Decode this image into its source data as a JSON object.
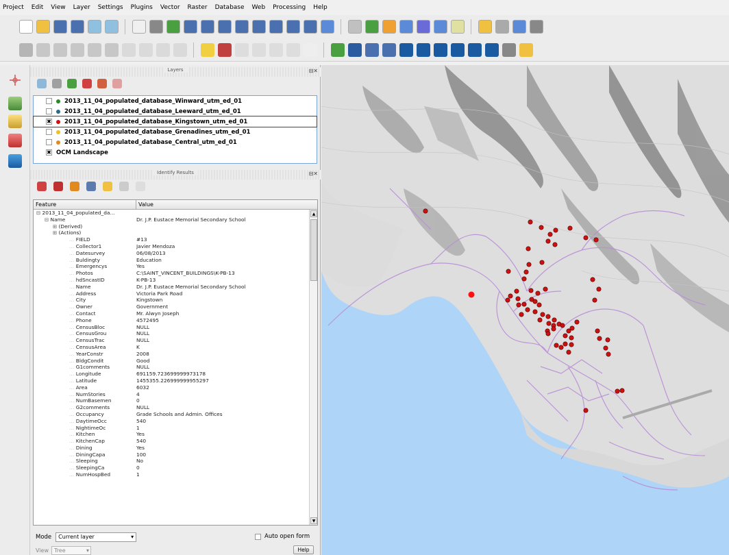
{
  "menu": [
    "Project",
    "Edit",
    "View",
    "Layer",
    "Settings",
    "Plugins",
    "Vector",
    "Raster",
    "Database",
    "Web",
    "Processing",
    "Help"
  ],
  "layers_panel": {
    "title": "Layers",
    "layers": [
      {
        "name": "2013_11_04_populated_database_Winward_utm_ed_01",
        "checked": false,
        "color": "#2a8a2a"
      },
      {
        "name": "2013_11_04_populated_database_Leeward_utm_ed_01",
        "checked": false,
        "color": "#2a6a8a"
      },
      {
        "name": "2013_11_04_populated_database_Kingstown_utm_ed_01",
        "checked": true,
        "color": "#cc1111",
        "selected": true
      },
      {
        "name": "2013_11_04_populated_database_Grenadines_utm_ed_01",
        "checked": false,
        "color": "#f0c020"
      },
      {
        "name": "2013_11_04_populated_database_Central_utm_ed_01",
        "checked": false,
        "color": "#e08a20"
      },
      {
        "name": "OCM Landscape",
        "checked": true
      }
    ]
  },
  "identify_panel": {
    "title": "Identify Results",
    "columns": [
      "Feature",
      "Value"
    ],
    "tree": [
      {
        "indent": 0,
        "toggle": "⊟",
        "feature": "2013_11_04_populated_da...",
        "value": ""
      },
      {
        "indent": 1,
        "toggle": "⊟",
        "feature": "Name",
        "value": "Dr. J.P. Eustace Memorial Secondary School"
      },
      {
        "indent": 2,
        "toggle": "⊞",
        "feature": "(Derived)",
        "value": ""
      },
      {
        "indent": 2,
        "toggle": "⊞",
        "feature": "(Actions)",
        "value": ""
      }
    ],
    "attributes": [
      [
        "FIELD",
        "#13"
      ],
      [
        "Collector1",
        "Javier Mendoza"
      ],
      [
        "Datesurvey",
        "06/08/2013"
      ],
      [
        "Buldingty",
        "Education"
      ],
      [
        "Emergencys",
        "Yes"
      ],
      [
        "Photos",
        "C:\\SAINT_VINCENT_BUILDINGS\\K-PB-13"
      ],
      [
        "hdSncastID",
        "K-PB-13"
      ],
      [
        "Name",
        "Dr. J.P. Eustace Memorial Secondary School"
      ],
      [
        "Address",
        "Victoria Park Road"
      ],
      [
        "City",
        "Kingstown"
      ],
      [
        "Owner",
        "Government"
      ],
      [
        "Contact",
        "Mr. Alwyn Joseph"
      ],
      [
        "Phone",
        "4572495"
      ],
      [
        "CensusBloc",
        "NULL"
      ],
      [
        "CensusGrou",
        "NULL"
      ],
      [
        "CensusTrac",
        "NULL"
      ],
      [
        "CensusArea",
        "K"
      ],
      [
        "YearConstr",
        "2008"
      ],
      [
        "BldgCondit",
        "Good"
      ],
      [
        "G1comments",
        "NULL"
      ],
      [
        "Longitude",
        "691159.723699999973178"
      ],
      [
        "Latitude",
        "1455355.226999999955297"
      ],
      [
        "Area",
        "6032"
      ],
      [
        "NumStories",
        "4"
      ],
      [
        "NumBasemen",
        "0"
      ],
      [
        "G2comments",
        "NULL"
      ],
      [
        "Occupancy",
        "Grade Schools and Admin. Offices"
      ],
      [
        "DaytimeOcc",
        "540"
      ],
      [
        "NightimeOc",
        "1"
      ],
      [
        "Kitchen",
        "Yes"
      ],
      [
        "KitchenCap",
        "540"
      ],
      [
        "Dining",
        "Yes"
      ],
      [
        "DiningCapa",
        "100"
      ],
      [
        "Sleeping",
        "No"
      ],
      [
        "SleepingCa",
        "0"
      ],
      [
        "NumHospBed",
        "1"
      ]
    ],
    "mode_label": "Mode",
    "mode_value": "Current layer",
    "auto_open_label": "Auto open form",
    "view_label": "View",
    "view_value": "Tree",
    "help_label": "Help"
  },
  "colors": {
    "sea": "#aed4f8",
    "land": "#dfdfdf",
    "roads": "#b98ed6",
    "points": "#cc1111",
    "selection_border": "#7aa5d9"
  }
}
